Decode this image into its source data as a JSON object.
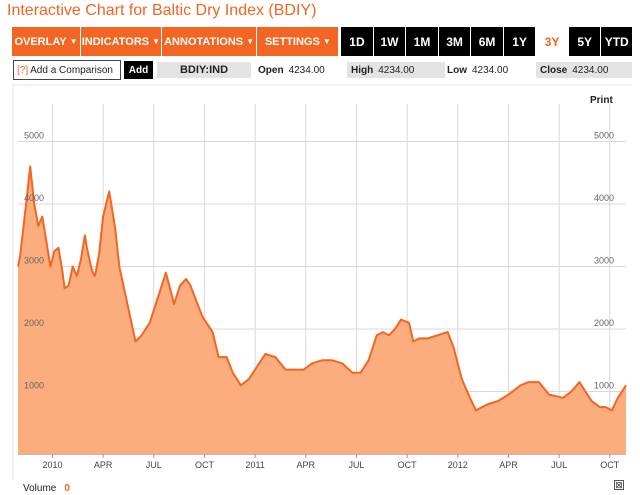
{
  "page_title": "Interactive Chart for Baltic Dry Index (BDIY)",
  "toolbar": {
    "menus": [
      {
        "label": "OVERLAY",
        "icon": "caret-down-icon"
      },
      {
        "label": "INDICATORS",
        "icon": "caret-down-icon"
      },
      {
        "label": "ANNOTATIONS",
        "icon": "caret-down-icon"
      },
      {
        "label": "SETTINGS",
        "icon": "caret-down-icon"
      }
    ],
    "caret_glyph": "▼",
    "ranges": [
      "1D",
      "1W",
      "1M",
      "3M",
      "6M",
      "1Y",
      "3Y",
      "5Y",
      "YTD"
    ],
    "active_range": "3Y"
  },
  "comparison": {
    "help": "[?]",
    "placeholder": "Add a Comparison",
    "add_label": "Add"
  },
  "quote": {
    "ticker": "BDIY:IND",
    "open_label": "Open",
    "open_value": "4234.00",
    "high_label": "High",
    "high_value": "4234.00",
    "low_label": "Low",
    "low_value": "4234.00",
    "close_label": "Close",
    "close_value": "4234.00"
  },
  "print_label": "Print",
  "volume": {
    "label": "Volume",
    "value": "0"
  },
  "close_icon": "⊠",
  "colors": {
    "accent": "#f26522",
    "area_fill": "#fcad7d",
    "line": "#f26522",
    "grid": "#d8d8d8"
  },
  "chart_data": {
    "type": "area",
    "y_ticks": [
      1000,
      2000,
      3000,
      4000,
      5000
    ],
    "ylim": [
      0,
      5600
    ],
    "grid": true,
    "x_ticks": [
      {
        "label": "2010",
        "x": 2010.0
      },
      {
        "label": "APR",
        "x": 2010.25
      },
      {
        "label": "JUL",
        "x": 2010.5
      },
      {
        "label": "OCT",
        "x": 2010.75
      },
      {
        "label": "2011",
        "x": 2011.0
      },
      {
        "label": "APR",
        "x": 2011.25
      },
      {
        "label": "JUL",
        "x": 2011.5
      },
      {
        "label": "OCT",
        "x": 2011.75
      },
      {
        "label": "2012",
        "x": 2012.0
      },
      {
        "label": "APR",
        "x": 2012.25
      },
      {
        "label": "JUL",
        "x": 2012.5
      },
      {
        "label": "OCT",
        "x": 2012.75
      }
    ],
    "xlim": [
      2009.83,
      2012.83
    ],
    "series": [
      {
        "x": [
          2009.83,
          2009.84,
          2009.87,
          2009.89,
          2009.9,
          2009.91,
          2009.93,
          2009.95,
          2009.97,
          2009.99,
          2010.01,
          2010.03,
          2010.05,
          2010.06,
          2010.08,
          2010.1,
          2010.12,
          2010.14,
          2010.16,
          2010.17,
          2010.19,
          2010.2,
          2010.21,
          2010.23,
          2010.25,
          2010.28,
          2010.31,
          2010.33,
          2010.35,
          2010.37,
          2010.39,
          2010.41,
          2010.44,
          2010.48,
          2010.52,
          2010.56,
          2010.6,
          2010.63,
          2010.66,
          2010.68,
          2010.71,
          2010.74,
          2010.76,
          2010.79,
          2010.82,
          2010.86,
          2010.89,
          2010.93,
          2010.97,
          2011.01,
          2011.05,
          2011.1,
          2011.15,
          2011.2,
          2011.24,
          2011.28,
          2011.33,
          2011.38,
          2011.43,
          2011.48,
          2011.52,
          2011.56,
          2011.6,
          2011.63,
          2011.66,
          2011.69,
          2011.72,
          2011.76,
          2011.78,
          2011.81,
          2011.85,
          2011.9,
          2011.95,
          2011.98,
          2012.02,
          2012.06,
          2012.09,
          2012.12,
          2012.15,
          2012.2,
          2012.25,
          2012.31,
          2012.35,
          2012.4,
          2012.45,
          2012.52,
          2012.56,
          2012.6,
          2012.63,
          2012.66,
          2012.7,
          2012.73,
          2012.76,
          2012.79,
          2012.83
        ],
        "y": [
          3000,
          3150,
          4000,
          4600,
          4300,
          4000,
          3650,
          3800,
          3400,
          3000,
          3250,
          3300,
          2900,
          2650,
          2700,
          3000,
          2850,
          3100,
          3500,
          3300,
          3000,
          2900,
          2850,
          3200,
          3800,
          4200,
          3600,
          3000,
          2700,
          2400,
          2100,
          1800,
          1900,
          2100,
          2500,
          2900,
          2400,
          2700,
          2800,
          2700,
          2450,
          2200,
          2100,
          1950,
          1550,
          1550,
          1300,
          1100,
          1200,
          1400,
          1600,
          1550,
          1350,
          1350,
          1350,
          1450,
          1500,
          1500,
          1450,
          1300,
          1300,
          1500,
          1900,
          1950,
          1900,
          2000,
          2150,
          2100,
          1800,
          1850,
          1850,
          1900,
          1950,
          1700,
          1200,
          900,
          700,
          750,
          800,
          850,
          950,
          1100,
          1150,
          1150,
          950,
          900,
          1000,
          1150,
          1000,
          850,
          750,
          750,
          700,
          900,
          1100
        ]
      }
    ]
  }
}
